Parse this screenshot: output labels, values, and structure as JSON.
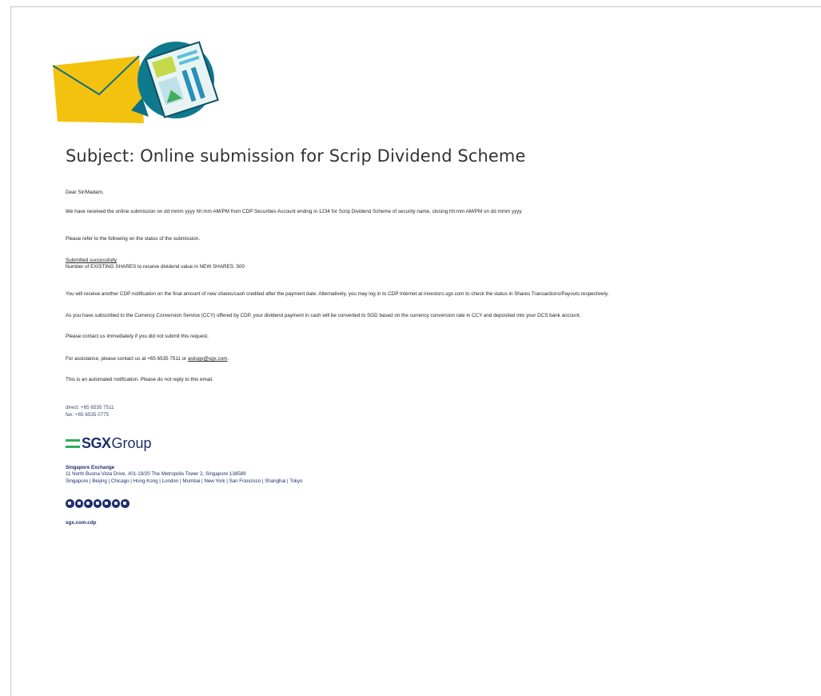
{
  "email": {
    "subject": "Subject: Online submission for Scrip Dividend Scheme",
    "greeting": "Dear Sir/Madam,",
    "para_received": "We have received the online submission on dd mmm yyyy hh:mm AM/PM from CDP Securities Account ending in 1234 for Scrip Dividend Scheme of security name, closing hh:mm AM/PM on dd mmm yyyy.",
    "para_refer": "Please refer to the following on the status of the submission.",
    "status_heading": "Submitted successfully",
    "status_detail": "Number of EXISTING SHARES to receive dividend value in NEW SHARES: 500",
    "para_notification": "You will receive another CDP notification on the final amount of new shares/cash credited after the payment date. Alternatively, you may log in to CDP Internet at investors.sgx.com to check the status in Shares Transactions/Payouts respectively.",
    "para_ccy": "As you have subscribed to the Currency Conversion Service (CCY) offered by CDP, your dividend payment in cash will be converted to SGD based on the currency conversion rate in CCY and deposited into your DCS bank account.",
    "para_contact": "Please contact us immediately if you did not submit this request.",
    "para_assist_prefix": "For assistance, please contact us at +65 6535 7511 or ",
    "assist_email": "asksgx@sgx.com",
    "para_assist_suffix": ".",
    "para_automated": "This is an automated notification. Please do not reply to this email."
  },
  "signature": {
    "direct": "direct: +65 6535 7511",
    "fax": "fax: +65 6535 0775",
    "logo_bold": "SGX",
    "logo_light": "Group",
    "org_name": "Singapore Exchange",
    "address": "11 North Buona Vista Drive, #01-19/20 The Metropolis Tower 2, Singapore 138589",
    "cities": "Singapore | Beijing | Chicago | Hong Kong | London | Mumbai | New York | San Francisco | Shanghai | Tokyo",
    "social_icons": [
      "facebook-icon",
      "linkedin-icon",
      "instagram-icon",
      "telegram-icon",
      "twitter-icon",
      "weibo-icon",
      "youtube-icon"
    ],
    "website": "sgx.com.cdp"
  },
  "colors": {
    "brand_navy": "#1f2e6e",
    "brand_green": "#2fae5a",
    "envelope_yellow": "#f2c20f",
    "bubble_teal": "#1a7a8c"
  }
}
